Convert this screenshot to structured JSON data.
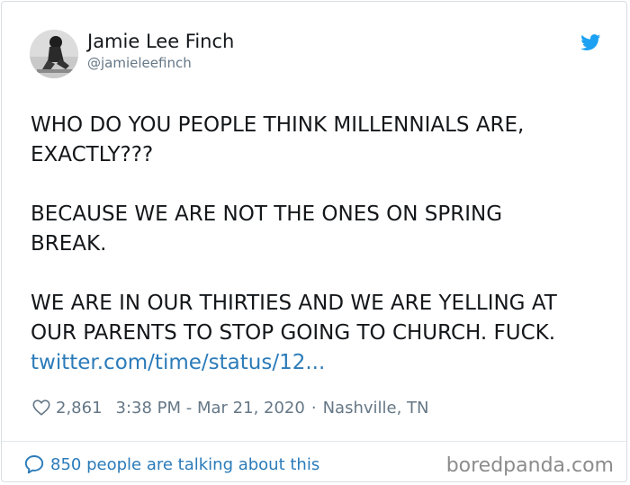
{
  "author": {
    "name": "Jamie Lee Finch",
    "handle": "@jamieleefinch"
  },
  "tweet": {
    "lines": [
      "WHO DO YOU PEOPLE THINK MILLENNIALS ARE,",
      "EXACTLY???",
      "BECAUSE WE ARE NOT THE ONES ON SPRING",
      "BREAK.",
      "WE ARE IN OUR THIRTIES AND WE ARE YELLING AT",
      "OUR PARENTS TO STOP GOING TO CHURCH. FUCK."
    ],
    "link": "twitter.com/time/status/12..."
  },
  "meta": {
    "likes": "2,861",
    "time": "3:38 PM - Mar 21, 2020",
    "separator": "·",
    "location": "Nashville, TN"
  },
  "footer": {
    "talking": "850 people are talking about this"
  },
  "watermark": "boredpanda.com",
  "icons": {
    "bird": "twitter-bird-icon",
    "heart": "heart-icon",
    "bubble": "speech-bubble-icon"
  },
  "colors": {
    "text": "#14171a",
    "muted": "#657786",
    "link": "#2b7bb9",
    "twitter_blue": "#1da1f2",
    "border": "#d9dee2"
  }
}
